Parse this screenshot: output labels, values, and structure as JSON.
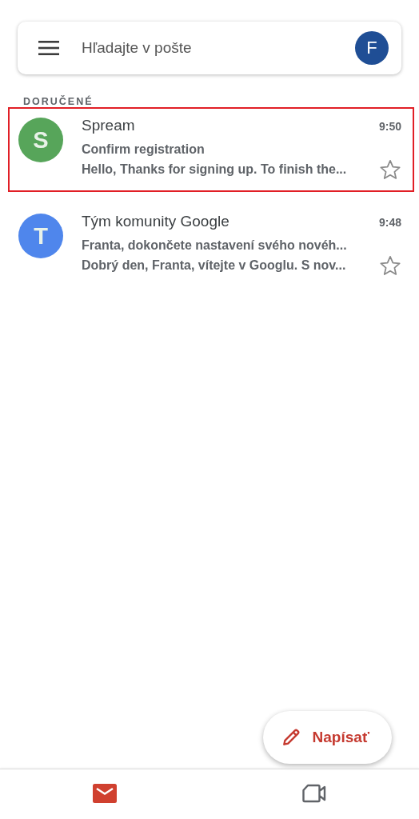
{
  "search": {
    "placeholder": "Hľadajte v pošte",
    "account_initial": "F"
  },
  "section_label": "DORUČENÉ",
  "emails": [
    {
      "initial": "S",
      "color": "#57a55a",
      "sender": "Spream",
      "time": "9:50",
      "subject": "Confirm registration",
      "snippet": "Hello, Thanks for signing up. To finish the...",
      "starred": false,
      "highlighted": true
    },
    {
      "initial": "T",
      "color": "#4f86ec",
      "sender": "Tým komunity Google",
      "time": "9:48",
      "subject": "Franta, dokončete nastavení svého novéh...",
      "snippet": "Dobrý den, Franta, vítejte v Googlu. S nov...",
      "starred": false,
      "highlighted": false
    }
  ],
  "compose_button": {
    "label": "Napísať"
  },
  "bottom_nav": [
    {
      "kind": "mail",
      "selected": true
    },
    {
      "kind": "video",
      "selected": false
    }
  ]
}
